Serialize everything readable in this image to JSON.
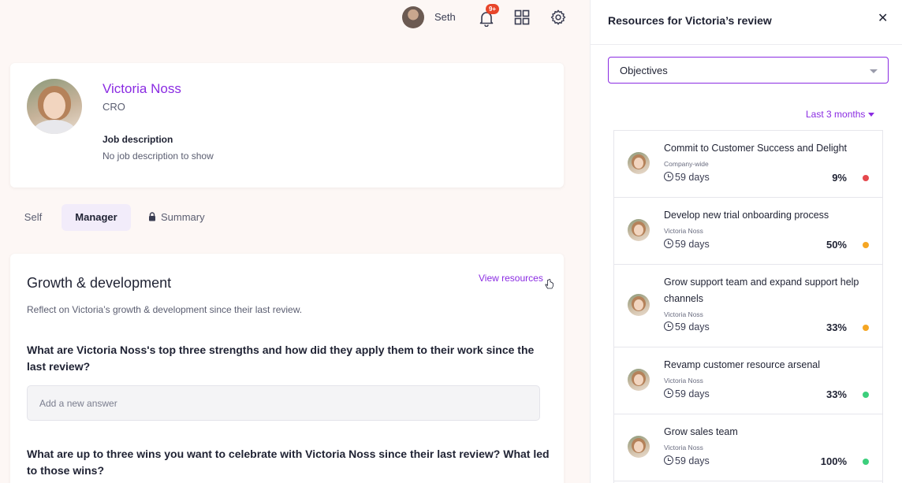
{
  "topbar": {
    "user_name": "Seth",
    "notification_badge": "9+",
    "icons": [
      "bell-icon",
      "apps-grid-icon",
      "gear-icon"
    ]
  },
  "profile": {
    "name": "Victoria Noss",
    "role": "CRO",
    "job_description_label": "Job description",
    "job_description_text": "No job description to show"
  },
  "tabs": [
    {
      "label": "Self",
      "active": false
    },
    {
      "label": "Manager",
      "active": true
    },
    {
      "label": "Summary",
      "active": false,
      "locked": true
    }
  ],
  "growth": {
    "title": "Growth & development",
    "view_resources_label": "View resources",
    "description": "Reflect on Victoria’s growth & development since their last review.",
    "question_1": "What are Victoria Noss's top three strengths and how did they apply them to their work since the last review?",
    "answer_placeholder": "Add a new answer",
    "question_2": "What are up to three wins you want to celebrate with Victoria Noss since their last review? What led to those wins?"
  },
  "panel": {
    "title": "Resources for Victoria’s review",
    "select_value": "Objectives",
    "range_label": "Last 3 months",
    "objectives": [
      {
        "title": "Commit to Customer Success and Delight",
        "owner": "Company-wide",
        "days": "59 days",
        "progress": "9%",
        "status_color": "#e5484d"
      },
      {
        "title": "Develop new trial onboarding process",
        "owner": "Victoria Noss",
        "days": "59 days",
        "progress": "50%",
        "status_color": "#f5a623"
      },
      {
        "title": "Grow support team and expand support help channels",
        "owner": "Victoria Noss",
        "days": "59 days",
        "progress": "33%",
        "status_color": "#f5a623"
      },
      {
        "title": "Revamp customer resource arsenal",
        "owner": "Victoria Noss",
        "days": "59 days",
        "progress": "33%",
        "status_color": "#3ccf7c"
      },
      {
        "title": "Grow sales team",
        "owner": "Victoria Noss",
        "days": "59 days",
        "progress": "100%",
        "status_color": "#3ccf7c"
      }
    ]
  },
  "colors": {
    "accent": "#8a2be2",
    "background": "#fdf7f5"
  }
}
